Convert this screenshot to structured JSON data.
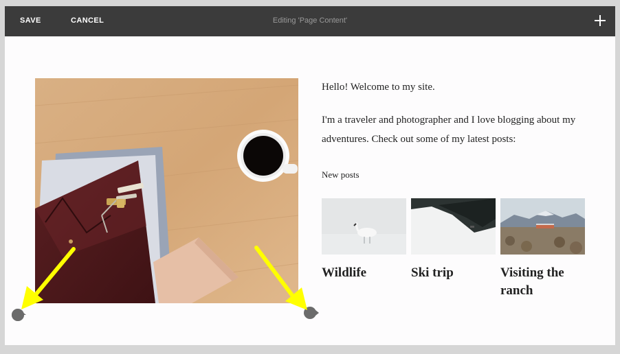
{
  "toolbar": {
    "save_label": "SAVE",
    "cancel_label": "CANCEL",
    "title": "Editing 'Page Content'",
    "add_icon": "plus-icon"
  },
  "content": {
    "greeting": "Hello! Welcome to my site.",
    "intro": "I'm a traveler and photographer and I love blogging about my adventures. Check out some of my latest posts:",
    "new_posts_label": "New posts",
    "posts": [
      {
        "title": "Wildlife"
      },
      {
        "title": "Ski trip"
      },
      {
        "title": "Visiting the ranch"
      }
    ]
  },
  "colors": {
    "toolbar_bg": "#3b3b3b",
    "page_bg": "#fdfcfd",
    "arrow": "#ffff00",
    "handle": "#6b6b6b"
  }
}
